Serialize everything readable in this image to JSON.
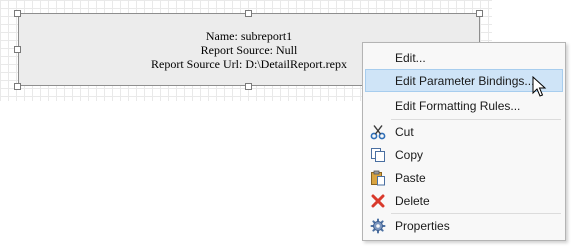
{
  "subreport": {
    "name_line": "Name: subreport1",
    "source_line": "Report Source: Null",
    "source_url_line": "Report Source Url: D:\\DetailReport.repx"
  },
  "context_menu": {
    "items": [
      {
        "label": "Edit...",
        "icon": "none"
      },
      {
        "label": "Edit Parameter Bindings...",
        "icon": "none",
        "highlighted": true
      },
      {
        "label": "Edit Formatting Rules...",
        "icon": "none"
      },
      {
        "label": "Cut",
        "icon": "scissors-icon"
      },
      {
        "label": "Copy",
        "icon": "copy-icon"
      },
      {
        "label": "Paste",
        "icon": "paste-icon"
      },
      {
        "label": "Delete",
        "icon": "delete-x-icon"
      },
      {
        "label": "Properties",
        "icon": "gear-icon"
      }
    ]
  },
  "colors": {
    "highlight": "#cfe4f7",
    "delete_icon": "#d9392b",
    "scissors_icon": "#2f6fb8"
  }
}
